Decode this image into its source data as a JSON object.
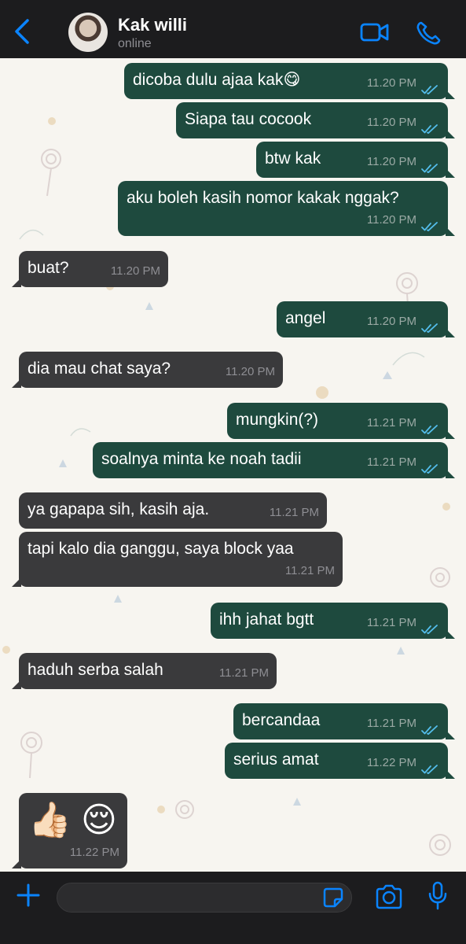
{
  "header": {
    "contact_name": "Kak willi",
    "status": "online",
    "icons": {
      "back": "chevron-left-icon",
      "video": "video-camera-icon",
      "call": "phone-icon"
    }
  },
  "messages": [
    {
      "dir": "out",
      "text": "dicoba dulu ajaa kak",
      "emoji": "😋",
      "time": "11.20 PM",
      "read": true
    },
    {
      "dir": "out",
      "text": "Siapa tau cocook",
      "time": "11.20 PM",
      "read": true
    },
    {
      "dir": "out",
      "text": "btw kak",
      "time": "11.20 PM",
      "read": true
    },
    {
      "dir": "out",
      "text": "aku boleh kasih nomor kakak nggak?",
      "time": "11.20 PM",
      "read": true
    },
    {
      "dir": "in",
      "text": "buat?",
      "time": "11.20 PM"
    },
    {
      "dir": "out",
      "text": "angel",
      "time": "11.20 PM",
      "read": true
    },
    {
      "dir": "in",
      "text": "dia mau chat saya?",
      "time": "11.20 PM"
    },
    {
      "dir": "out",
      "text": "mungkin(?)",
      "time": "11.21 PM",
      "read": true
    },
    {
      "dir": "out",
      "text": "soalnya minta ke noah tadii",
      "time": "11.21 PM",
      "read": true
    },
    {
      "dir": "in",
      "text": "ya gapapa sih, kasih aja.",
      "time": "11.21 PM"
    },
    {
      "dir": "in",
      "text": "tapi kalo dia ganggu, saya block yaa",
      "time": "11.21 PM"
    },
    {
      "dir": "out",
      "text": "ihh jahat bgtt",
      "time": "11.21 PM",
      "read": true
    },
    {
      "dir": "in",
      "text": "haduh serba salah",
      "time": "11.21 PM"
    },
    {
      "dir": "out",
      "text": "bercandaa",
      "time": "11.21 PM",
      "read": true
    },
    {
      "dir": "out",
      "text": "serius amat",
      "time": "11.22 PM",
      "read": true
    },
    {
      "dir": "in",
      "text": "👍🏻 😌",
      "time": "11.22 PM",
      "emoji_only": true
    }
  ],
  "footer": {
    "input_value": "",
    "icons": {
      "plus": "plus-icon",
      "sticker": "sticker-icon",
      "camera": "camera-icon",
      "mic": "microphone-icon"
    }
  },
  "colors": {
    "accent": "#0a84ff",
    "outgoing_bubble": "#1e4a3e",
    "incoming_bubble": "#3a3a3c",
    "read_ticks": "#53bdeb"
  }
}
